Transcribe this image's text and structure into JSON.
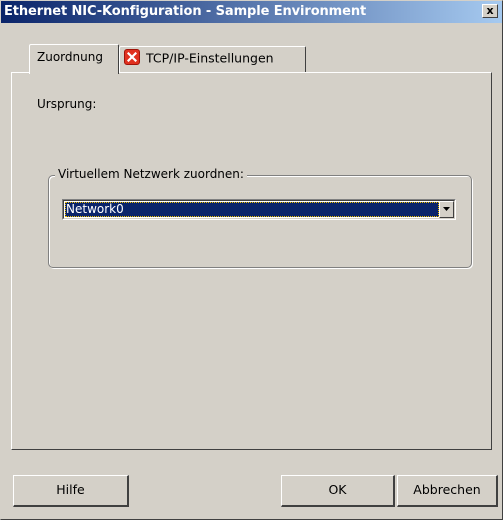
{
  "window": {
    "title": "Ethernet NIC-Konfiguration - Sample Environment",
    "close_glyph": "x"
  },
  "tabs": [
    {
      "label": "Zuordnung",
      "active": true
    },
    {
      "label": "TCP/IP-Einstellungen",
      "active": false,
      "icon": "error-icon"
    }
  ],
  "panel": {
    "origin_label": "Ursprung:",
    "group_label": "Virtuellem Netzwerk zuordnen:",
    "network_select": {
      "selected": "Network0"
    }
  },
  "buttons": {
    "help": "Hilfe",
    "ok": "OK",
    "cancel": "Abbrechen"
  },
  "colors": {
    "dialog_bg": "#d4d0c8",
    "titlebar_start": "#0a246a",
    "titlebar_end": "#a6caf0",
    "selection_bg": "#0a246a",
    "error_icon": "#e0301e"
  }
}
